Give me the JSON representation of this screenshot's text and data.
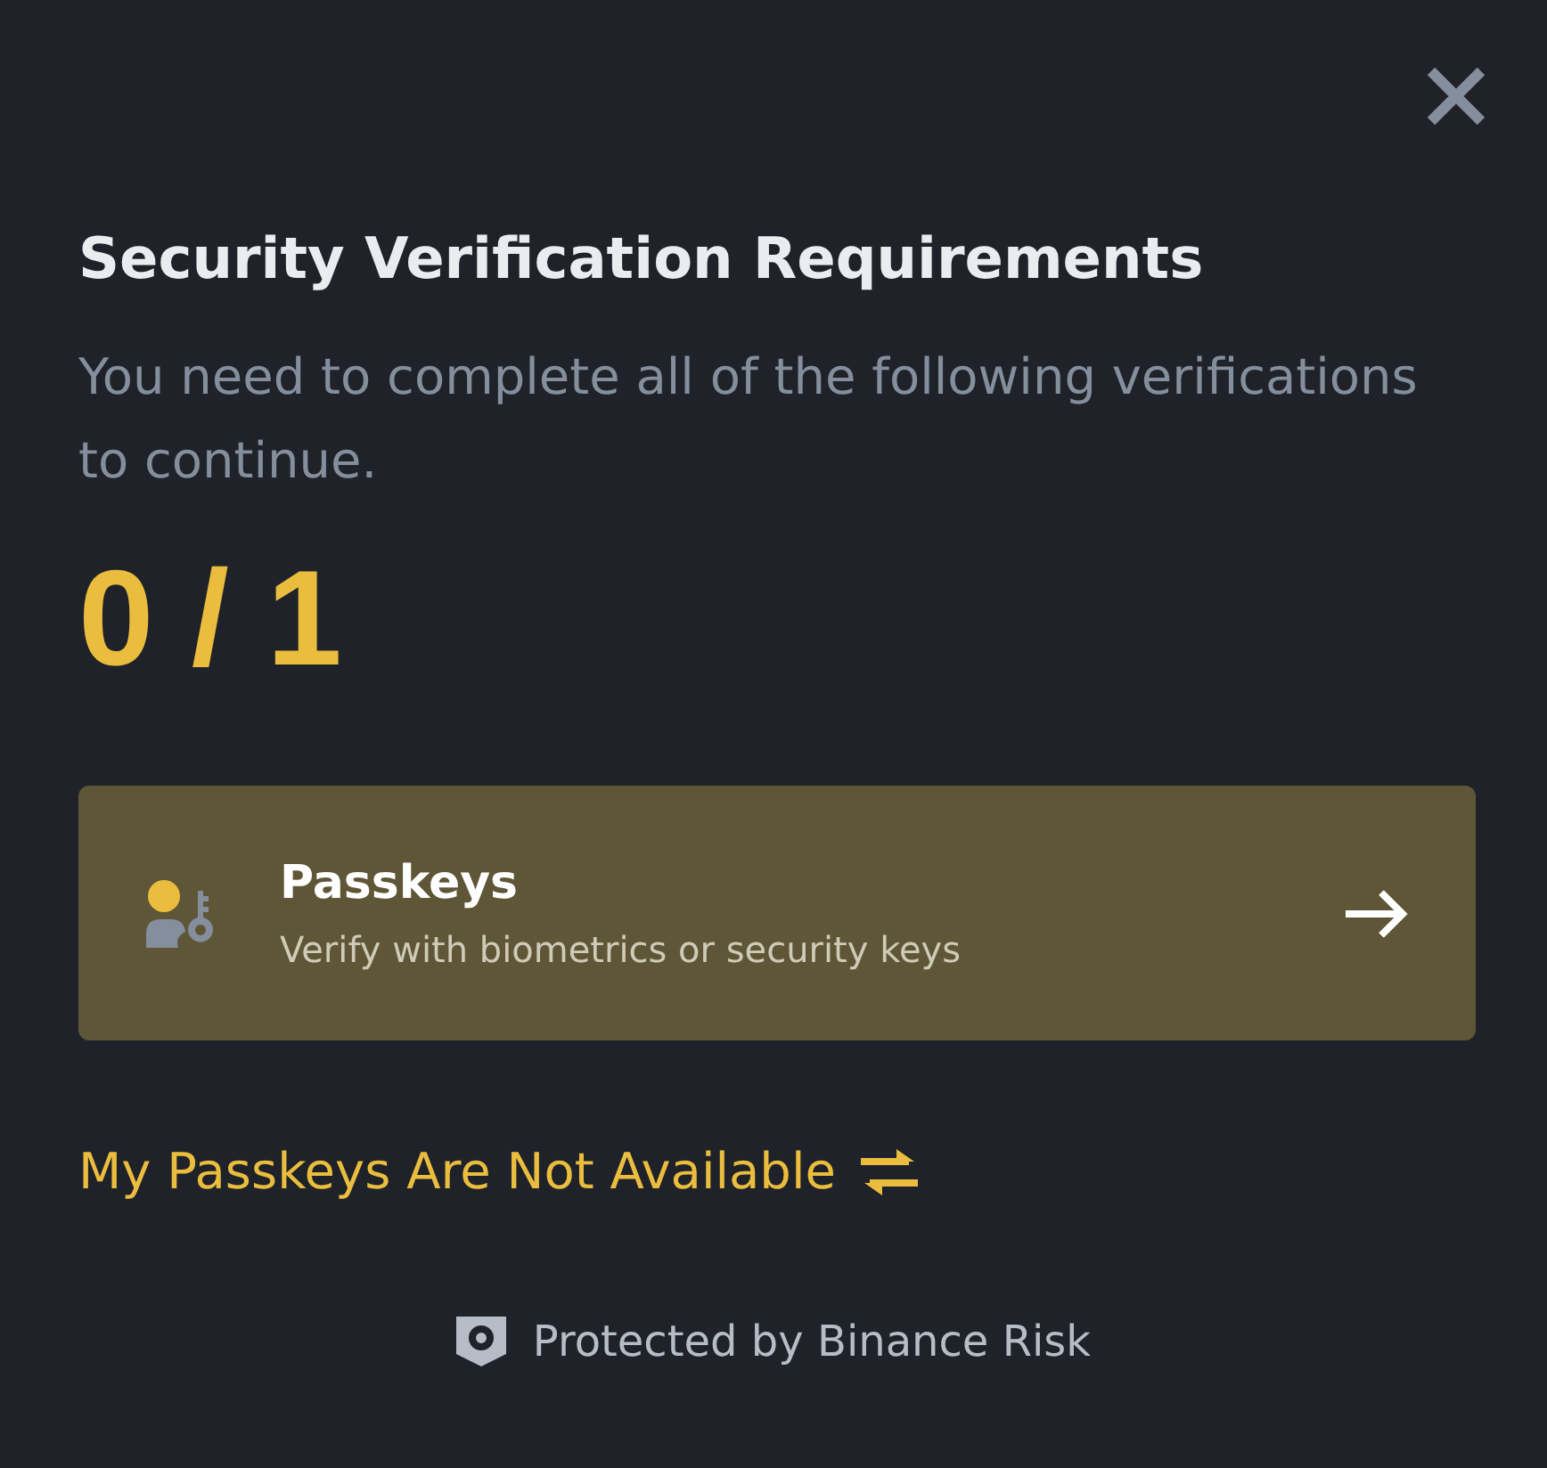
{
  "dialog": {
    "title": "Security Verification Requirements",
    "description": "You need to complete all of the following verifications to continue.",
    "progress": "0 / 1",
    "methods": [
      {
        "kind": "passkey",
        "title": "Passkeys",
        "description": "Verify with biometrics or security keys"
      }
    ],
    "alternate_link": "My Passkeys Are Not Available",
    "footer": "Protected by Binance Risk"
  }
}
